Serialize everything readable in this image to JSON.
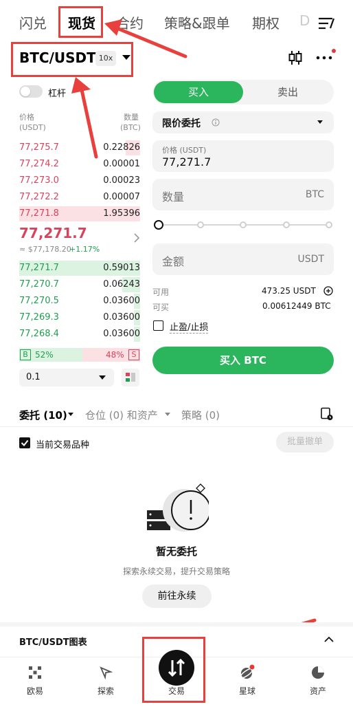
{
  "top_tabs": [
    "闪兑",
    "现货",
    "合约",
    "策略&跟单",
    "期权",
    "D"
  ],
  "pair": {
    "name": "BTC/USDT",
    "leverage": "10x"
  },
  "margin": {
    "label": "杠杆"
  },
  "orderbook": {
    "price_header": "价格",
    "price_unit": "(USDT)",
    "qty_header": "数量",
    "qty_unit": "(BTC)",
    "asks": [
      {
        "price": "77,275.7",
        "qty": "0.22826",
        "depth": 0.12
      },
      {
        "price": "77,274.2",
        "qty": "0.00001",
        "depth": 0.0
      },
      {
        "price": "77,273.0",
        "qty": "0.00023",
        "depth": 0.0
      },
      {
        "price": "77,272.2",
        "qty": "0.00007",
        "depth": 0.0
      },
      {
        "price": "77,271.8",
        "qty": "1.95396",
        "depth": 1.0
      }
    ],
    "last_price": "77,271.7",
    "last_usd": "≈ $77,178.20",
    "last_change": "+1.17%",
    "bids": [
      {
        "price": "77,271.7",
        "qty": "0.59013",
        "depth": 1.0
      },
      {
        "price": "77,270.7",
        "qty": "0.06243",
        "depth": 0.15
      },
      {
        "price": "77,270.5",
        "qty": "0.03600",
        "depth": 0.05
      },
      {
        "price": "77,269.3",
        "qty": "0.03600",
        "depth": 0.05
      },
      {
        "price": "77,268.4",
        "qty": "0.03600",
        "depth": 0.05
      }
    ],
    "buy_ratio_label": "B",
    "buy_ratio": "52%",
    "sell_ratio": "48%",
    "sell_ratio_label": "S",
    "precision": "0.1"
  },
  "form": {
    "buy_tab": "买入",
    "sell_tab": "卖出",
    "order_type": "限价委托",
    "price_label": "价格 (USDT)",
    "price_value": "77,271.7",
    "qty_placeholder": "数量",
    "qty_unit": "BTC",
    "amount_placeholder": "金额",
    "amount_unit": "USDT",
    "available_label": "可用",
    "available_value": "473.25 USDT",
    "can_buy_label": "可买",
    "can_buy_value": "0.00612449 BTC",
    "tpsl_label": "止盈/止损",
    "submit_label": "买入 BTC"
  },
  "orders": {
    "tabs": [
      "委托 (10)",
      "仓位 (0) 和资产",
      "策略 (0)"
    ],
    "current_pair_label": "当前交易品种",
    "batch_cancel": "批量撤单",
    "empty_title": "暂无委托",
    "empty_desc": "探索永续交易，提升交易策略",
    "goto_label": "前往永续"
  },
  "chart_panel": {
    "title": "BTC/USDT图表"
  },
  "bottom_nav": [
    "欧易",
    "探索",
    "交易",
    "星球",
    "资产"
  ],
  "colors": {
    "buy_green": "#2bb55c",
    "ask_red": "#d9445d",
    "bid_green": "#1e9e4f",
    "annotation_red": "#e8413d"
  },
  "icons": [
    "menu-icon",
    "candlestick-icon",
    "more-icon",
    "info-icon",
    "add-circle-icon",
    "book-layout-icon",
    "order-history-icon",
    "trade-icon",
    "explore-icon",
    "planet-icon",
    "assets-icon",
    "okx-logo-icon",
    "empty-orders-icon"
  ]
}
